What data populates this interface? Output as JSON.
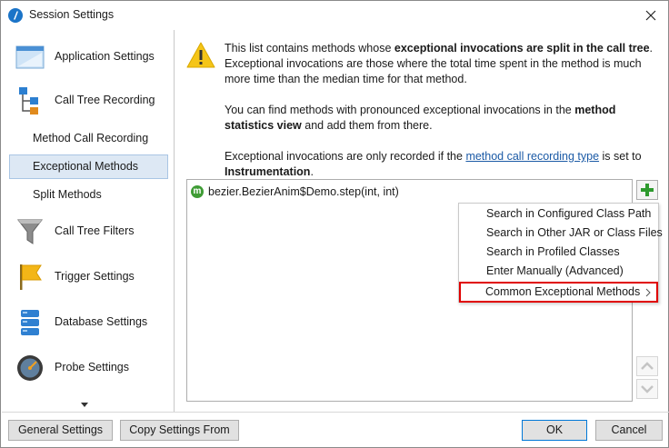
{
  "window": {
    "title": "Session Settings"
  },
  "sidebar": {
    "items": [
      {
        "label": "Application Settings",
        "icon": "application-settings-icon"
      },
      {
        "label": "Call Tree Recording",
        "icon": "call-tree-icon"
      },
      {
        "label": "Method Call Recording"
      },
      {
        "label": "Exceptional Methods",
        "selected": true
      },
      {
        "label": "Split Methods"
      },
      {
        "label": "Call Tree Filters",
        "icon": "funnel-icon"
      },
      {
        "label": "Trigger Settings",
        "icon": "flag-icon"
      },
      {
        "label": "Database Settings",
        "icon": "database-icon"
      },
      {
        "label": "Probe Settings",
        "icon": "gauge-icon"
      }
    ]
  },
  "info": {
    "p1_prefix": "This list contains methods whose ",
    "p1_bold": "exceptional invocations are split in the call tree",
    "p1_suffix": ". Exceptional invocations are those where the total time spent in the method is much more time than the median time for that method.",
    "p2_prefix": "You can find methods with pronounced exceptional invocations in the ",
    "p2_bold": "method statistics view",
    "p2_suffix": " and add them from there.",
    "p3_prefix": "Exceptional invocations are only recorded if the ",
    "p3_link": "method call recording type",
    "p3_mid": " is set to ",
    "p3_bold": "Instrumentation",
    "p3_suffix": "."
  },
  "method_list": {
    "rows": [
      {
        "badge": "m",
        "label": "bezier.BezierAnim$Demo.step(int, int)"
      }
    ]
  },
  "popup_menu": {
    "items": [
      "Search in Configured Class Path",
      "Search in Other JAR or Class Files",
      "Search in Profiled Classes",
      "Enter Manually (Advanced)",
      "Common Exceptional Methods"
    ]
  },
  "footer": {
    "general_settings": "General Settings",
    "copy_settings_from": "Copy Settings From",
    "ok": "OK",
    "cancel": "Cancel"
  },
  "colors": {
    "accent": "#0078d7",
    "selection": "#dde8f4",
    "highlight_border": "#e00000",
    "badge_green": "#3f9c35",
    "link": "#1b5aa6"
  }
}
